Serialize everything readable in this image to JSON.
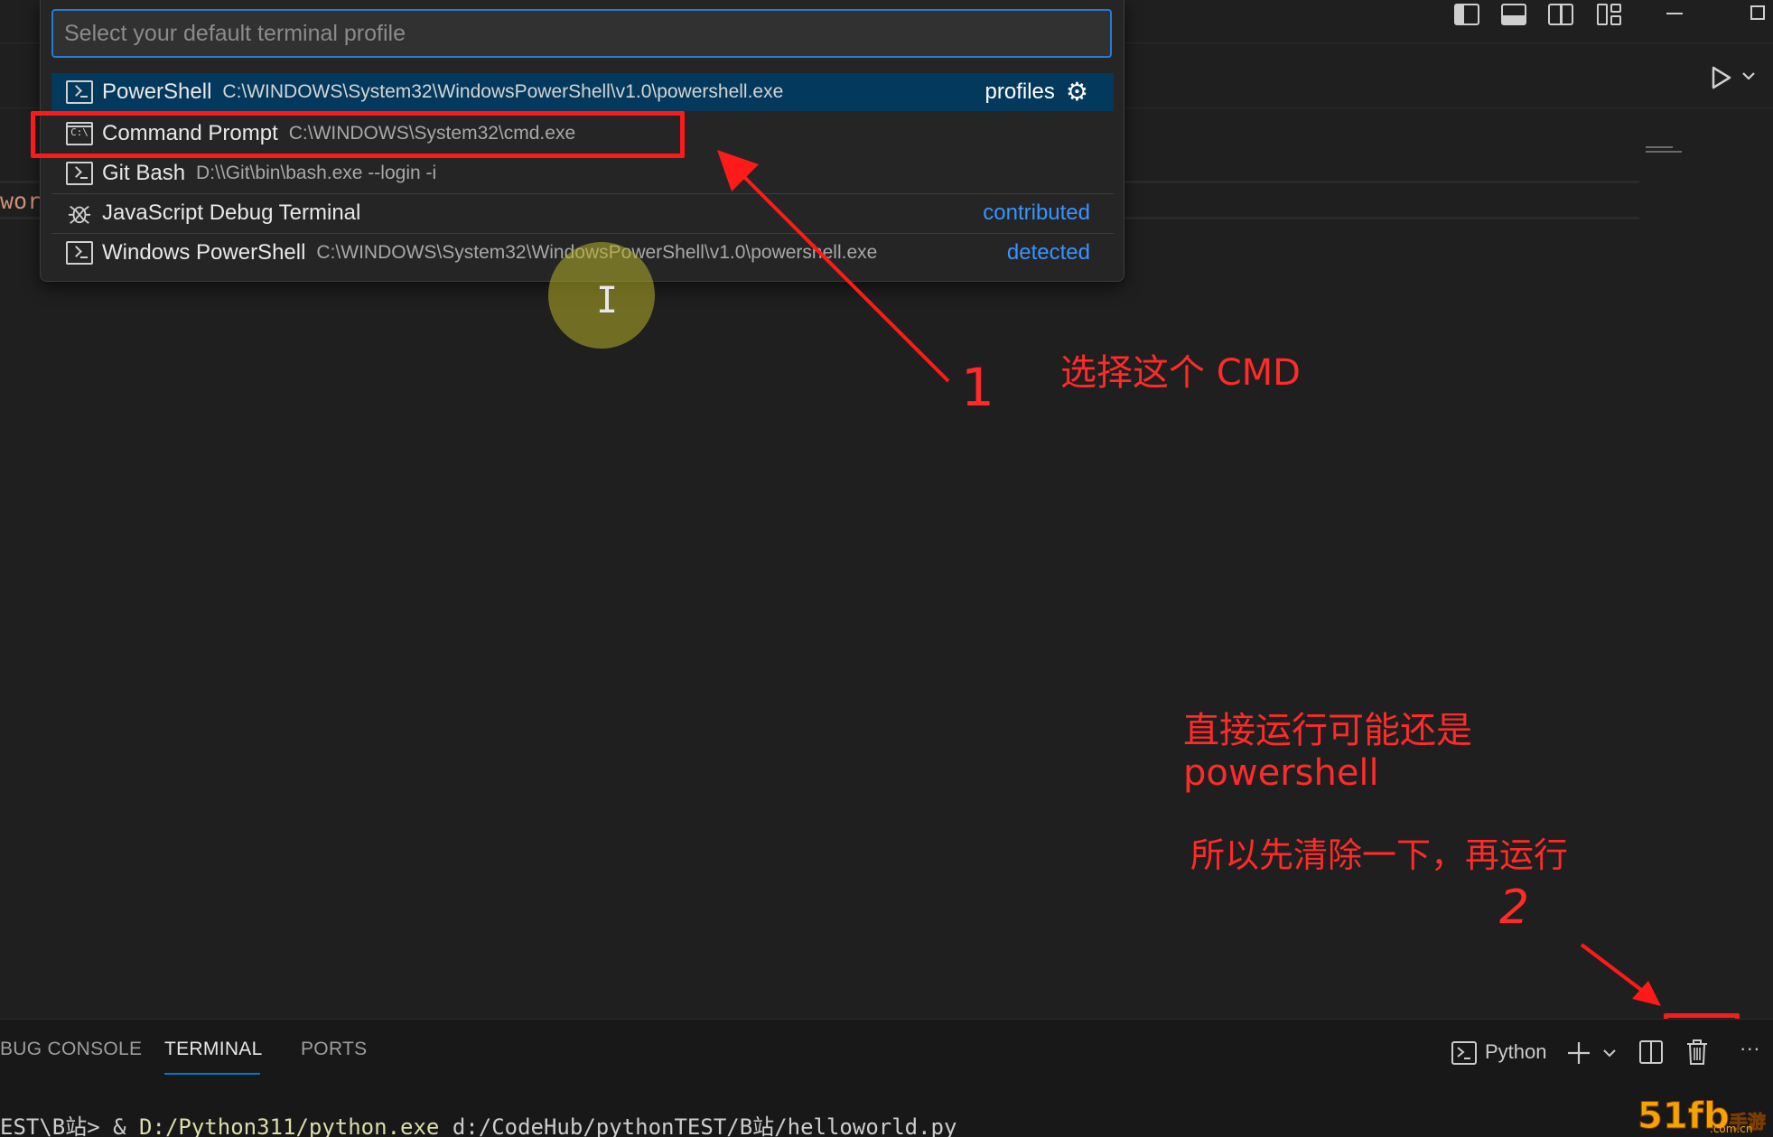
{
  "quick_pick": {
    "placeholder": "Select your default terminal profile",
    "items": [
      {
        "label": "PowerShell",
        "description": "C:\\WINDOWS\\System32\\WindowsPowerShell\\v1.0\\powershell.exe",
        "tag": "profiles",
        "icon": "terminal-icon",
        "selected": true
      },
      {
        "label": "Command Prompt",
        "description": "C:\\WINDOWS\\System32\\cmd.exe",
        "tag": "",
        "icon": "cmd-icon",
        "icon_text": "C:\\"
      },
      {
        "label": "Git Bash",
        "description": "D:\\\\Git\\bin\\bash.exe --login -i",
        "tag": "",
        "icon": "terminal-icon"
      },
      {
        "label": "JavaScript Debug Terminal",
        "description": "",
        "tag": "contributed",
        "icon": "debug-bug-icon"
      },
      {
        "label": "Windows PowerShell",
        "description": "C:\\WINDOWS\\System32\\WindowsPowerShell\\v1.0\\powershell.exe",
        "tag": "detected",
        "icon": "terminal-icon"
      }
    ]
  },
  "editor": {
    "code_fragment": "wor"
  },
  "annotations": {
    "step1_number": "1",
    "step1_text": "选择这个 CMD",
    "step2_line1": "直接运行可能还是",
    "step2_line2": "powershell",
    "step2_line3": "所以先清除一下，再运行",
    "step2_number": "2",
    "color": "#ff1a1a"
  },
  "panel": {
    "tabs": [
      {
        "label": "BUG CONSOLE",
        "active": false
      },
      {
        "label": "TERMINAL",
        "active": true
      },
      {
        "label": "PORTS",
        "active": false
      }
    ],
    "terminal_name": "Python",
    "terminal_line": {
      "prefix": "EST\\B站> & ",
      "exe": "D:/Python311/python.exe",
      "args": " d:/CodeHub/pythonTEST/B站/helloworld.py"
    },
    "more": "···"
  },
  "watermark": {
    "main": "51fb",
    "side": "手游网",
    "domain": ".com.cn"
  },
  "colors": {
    "background": "#1f1f1f",
    "selection": "#04395e",
    "accent": "#0078d4",
    "link": "#3794ff"
  }
}
